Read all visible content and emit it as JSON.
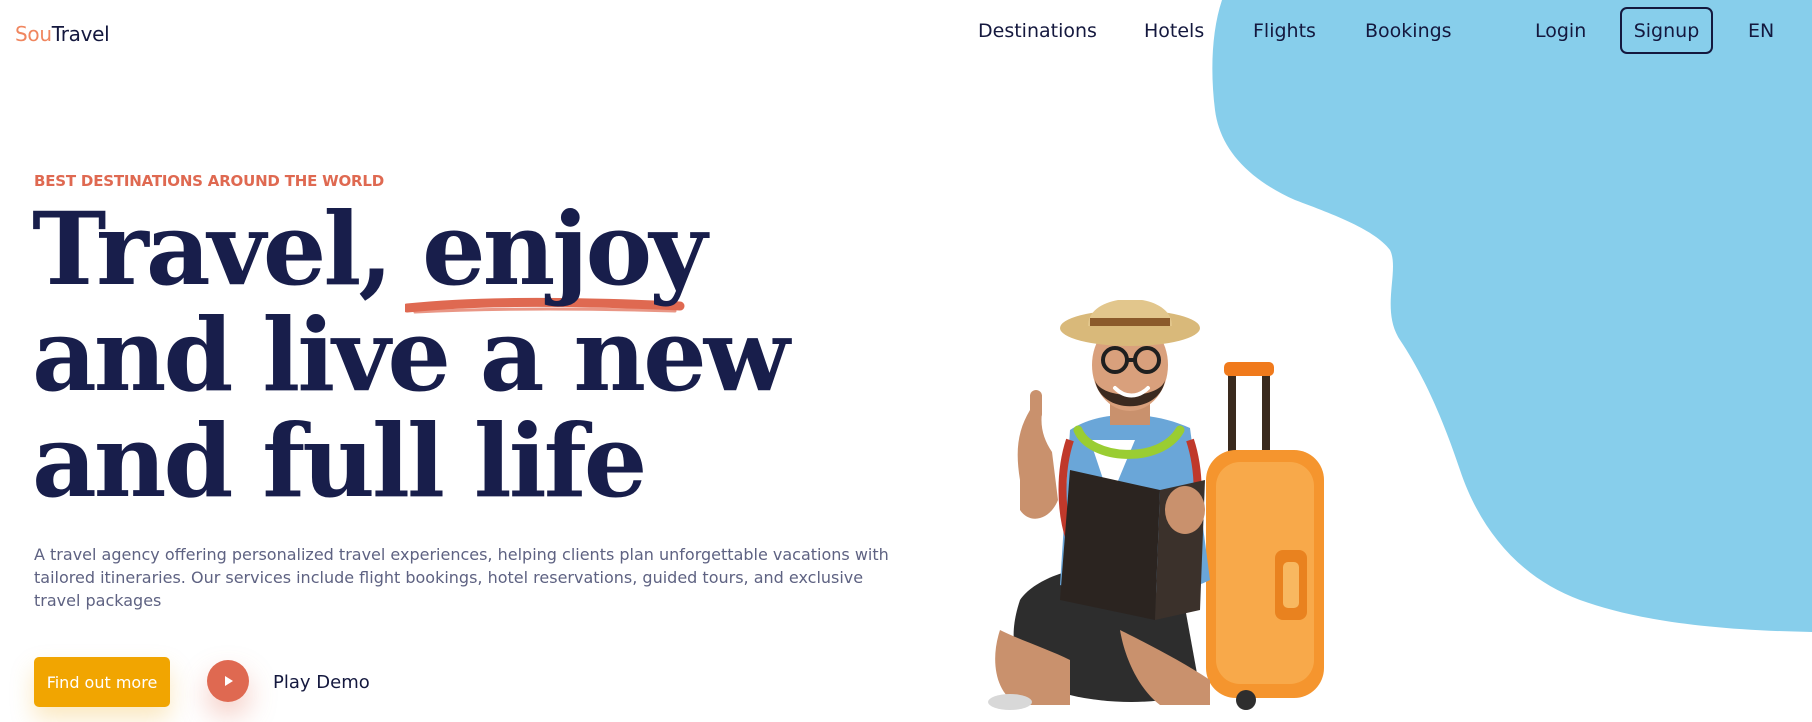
{
  "brand": {
    "logo_part1": "Sou",
    "logo_part2": "Travel"
  },
  "nav": {
    "items": [
      {
        "label": "Destinations"
      },
      {
        "label": "Hotels"
      },
      {
        "label": "Flights"
      },
      {
        "label": "Bookings"
      }
    ],
    "login_label": "Login",
    "signup_label": "Signup",
    "language": "EN"
  },
  "hero": {
    "eyebrow": "BEST DESTINATIONS AROUND THE WORLD",
    "headline_lines": [
      "Travel, enjoy",
      "and live a new",
      "and full life"
    ],
    "description": "A travel agency offering personalized travel experiences, helping clients plan unforgettable vacations with tailored itineraries. Our services include flight bookings, hotel reservations, guided tours, and exclusive travel packages",
    "cta_label": "Find out more",
    "play_label": "Play Demo"
  },
  "colors": {
    "primary_text": "#181e4b",
    "accent": "#df6951",
    "cta": "#f1a501",
    "blob": "#87ceeb",
    "logo_accent": "#f0865f",
    "body_text": "#5e6282"
  },
  "icons": {
    "play": "play-icon",
    "traveler": "traveler-illustration"
  }
}
